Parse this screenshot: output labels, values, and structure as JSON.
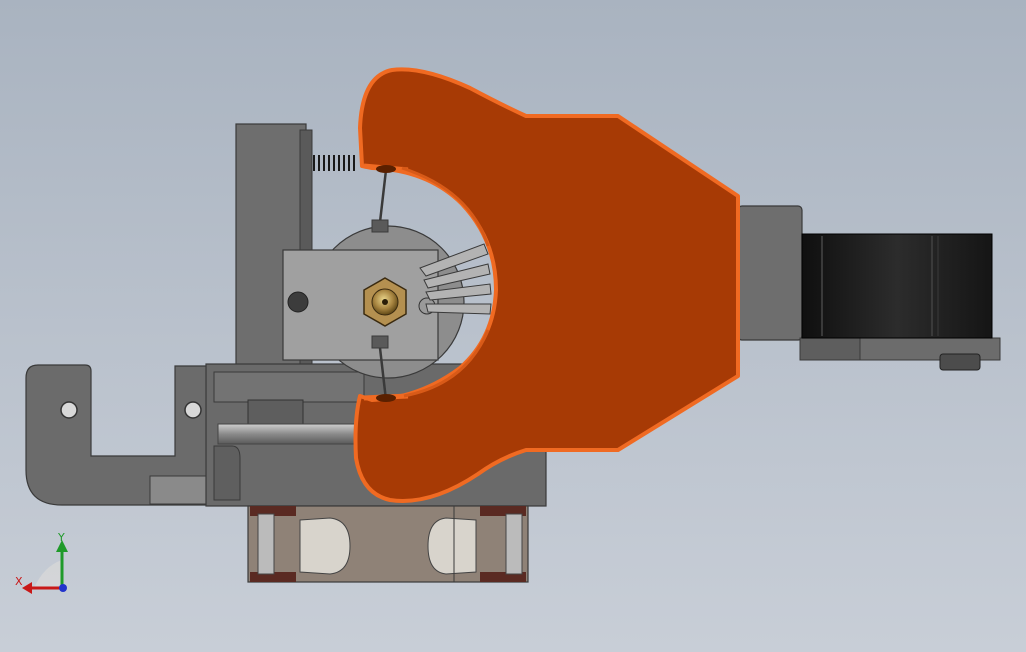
{
  "scene": {
    "background_gradient": [
      "#a9b3c0",
      "#b9c1cc",
      "#c8ced7"
    ],
    "part_colors": {
      "fan_duct": "#a63a05",
      "fan_duct_edge": "#f06a22",
      "frame_gray": "#6e6e6e",
      "frame_light": "#8a8a8a",
      "stepper_black": "#1c1c1c",
      "heater_block": "#9e9e9e",
      "nozzle_brass": "#9a7a3a",
      "fan_housing": "#8f8277"
    }
  },
  "triad": {
    "x_label": "X",
    "y_label": "Y",
    "x_color": "#c81818",
    "y_color": "#1f9a2a",
    "z_color": "#2233cc"
  }
}
